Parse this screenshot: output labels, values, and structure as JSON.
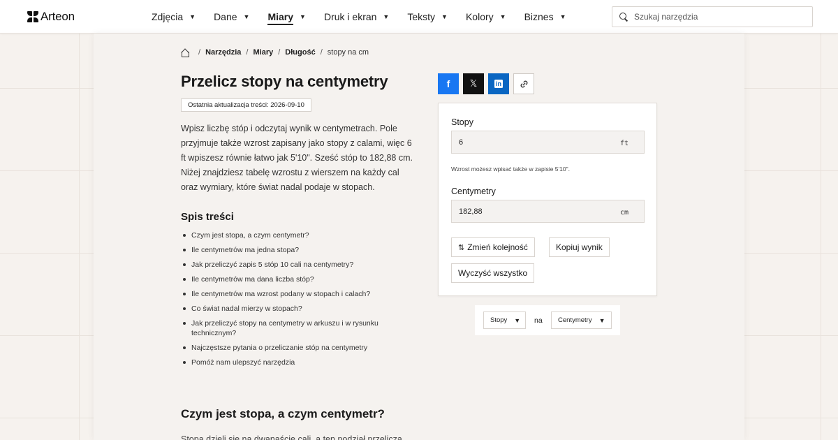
{
  "header": {
    "logo_text": "Arteon",
    "nav": [
      {
        "label": "Zdjęcia"
      },
      {
        "label": "Dane"
      },
      {
        "label": "Miary",
        "active": true
      },
      {
        "label": "Druk i ekran"
      },
      {
        "label": "Teksty"
      },
      {
        "label": "Kolory"
      },
      {
        "label": "Biznes"
      }
    ],
    "search_placeholder": "Szukaj narzędzia"
  },
  "breadcrumb": {
    "items": [
      "Narzędzia",
      "Miary",
      "Długość"
    ],
    "current": "stopy na cm"
  },
  "page": {
    "title": "Przelicz stopy na centymetry",
    "updated": "Ostatnia aktualizacja treści: 2026-09-10",
    "intro": "Wpisz liczbę stóp i odczytaj wynik w centymetrach. Pole przyjmuje także wzrost zapisany jako stopy z calami, więc 6 ft wpiszesz równie łatwo jak 5'10\". Sześć stóp to 182,88 cm. Niżej znajdziesz tabelę wzrostu z wierszem na każdy cal oraz wymiary, które świat nadal podaje w stopach.",
    "toc_title": "Spis treści",
    "toc": [
      "Czym jest stopa, a czym centymetr?",
      "Ile centymetrów ma jedna stopa?",
      "Jak przeliczyć zapis 5 stóp 10 cali na centymetry?",
      "Ile centymetrów ma dana liczba stóp?",
      "Ile centymetrów ma wzrost podany w stopach i calach?",
      "Co świat nadal mierzy w stopach?",
      "Jak przeliczyć stopy na centymetry w arkuszu i w rysunku technicznym?",
      "Najczęstsze pytania o przeliczanie stóp na centymetry",
      "Pomóż nam ulepszyć narzędzia"
    ],
    "section_title": "Czym jest stopa, a czym centymetr?",
    "section_text": "Stopa dzieli się na dwanaście cali, a ten podział przelicza"
  },
  "share": {
    "facebook_glyph": "f",
    "x_glyph": "𝕏",
    "linkedin_glyph": "in",
    "link_glyph": "🔗"
  },
  "converter": {
    "from_label": "Stopy",
    "from_value": "6",
    "from_unit": "ft",
    "hint": "Wzrost możesz wpisać także w zapisie 5'10\".",
    "to_label": "Centymetry",
    "to_value": "182,88",
    "to_unit": "cm",
    "swap_label": "Zmień kolejność",
    "copy_label": "Kopiuj wynik",
    "clear_label": "Wyczyść wszystko"
  },
  "unit_selector": {
    "from": "Stopy",
    "between": "na",
    "to": "Centymetry"
  },
  "colors": {
    "facebook": "#1877f2",
    "x": "#111111",
    "linkedin": "#0a66c2",
    "background": "#f6f2ee"
  }
}
